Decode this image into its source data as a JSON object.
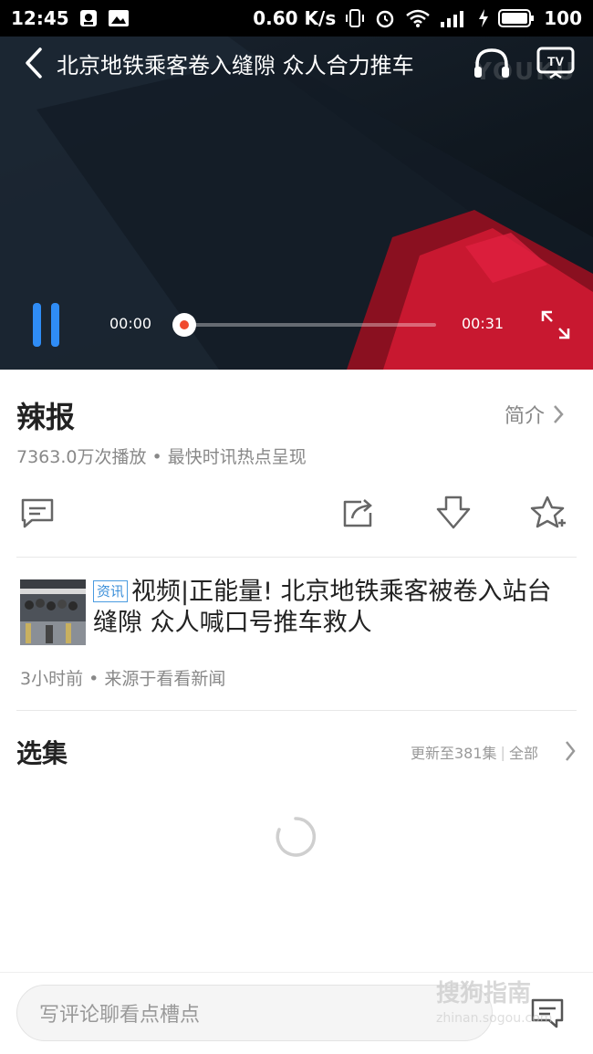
{
  "status_bar": {
    "time": "12:45",
    "network_speed": "0.60 K/s",
    "battery": "100"
  },
  "video": {
    "title": "北京地铁乘客卷入缝隙 众人合力推车",
    "watermark": "YOUKU",
    "current_time": "00:00",
    "total_time": "00:31",
    "progress": 0,
    "accent_color": "#2f8cf5"
  },
  "show": {
    "title": "辣报",
    "intro_label": "简介",
    "meta": "7363.0万次播放 • 最快时讯热点呈现"
  },
  "actions": {
    "comment_icon": "comment-icon",
    "share_icon": "share-icon",
    "download_icon": "download-icon",
    "favorite_icon": "favorite-add-icon"
  },
  "news": {
    "tag": "资讯",
    "title": "视频|正能量! 北京地铁乘客被卷入站台缝隙 众人喊口号推车救人",
    "meta": "3小时前 • 来源于看看新闻"
  },
  "episodes": {
    "title": "选集",
    "update_text": "更新至381集",
    "all_label": "全部"
  },
  "bottom_bar": {
    "comment_placeholder": "写评论聊看点槽点"
  },
  "page_watermark": {
    "brand": "搜狗指南",
    "url": "zhinan.sogou.com"
  }
}
